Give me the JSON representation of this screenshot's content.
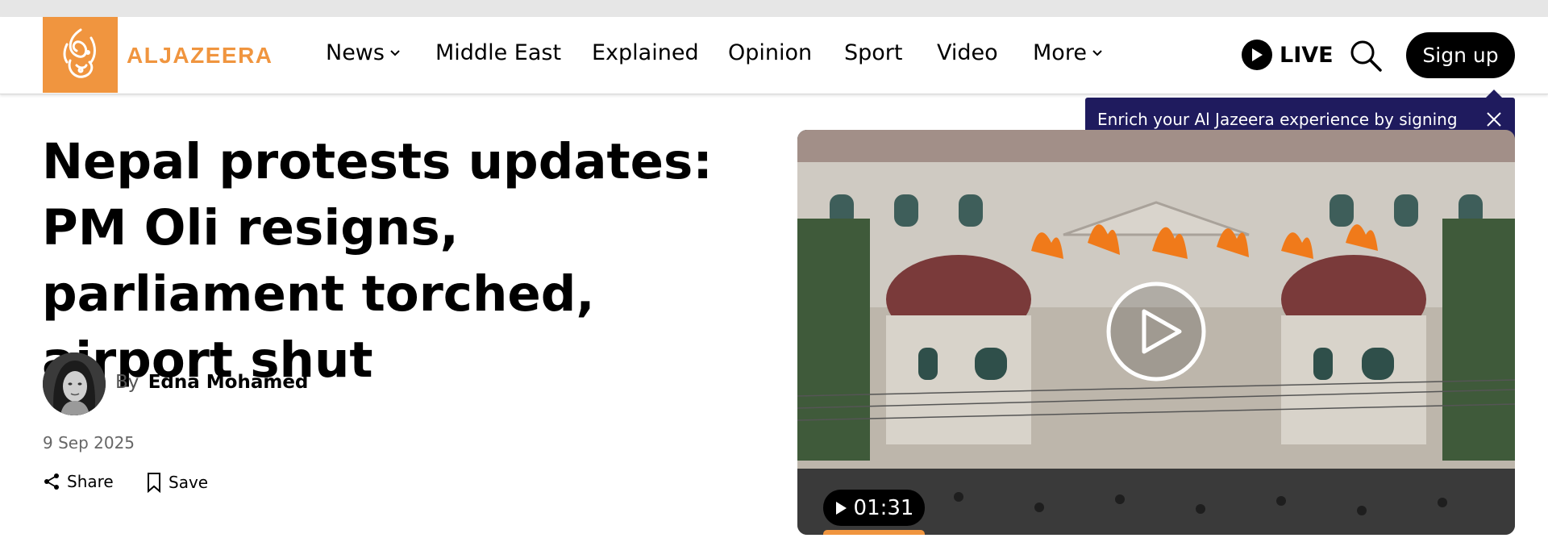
{
  "brand": {
    "logo_text": "ALJAZEERA",
    "accent": "#f0953f"
  },
  "nav": {
    "items": [
      {
        "label": "News",
        "has_dropdown": true
      },
      {
        "label": "Middle East",
        "has_dropdown": false
      },
      {
        "label": "Explained",
        "has_dropdown": false
      },
      {
        "label": "Opinion",
        "has_dropdown": false
      },
      {
        "label": "Sport",
        "has_dropdown": false
      },
      {
        "label": "Video",
        "has_dropdown": false
      },
      {
        "label": "More",
        "has_dropdown": true
      }
    ],
    "live_label": "LIVE",
    "signup_label": "Sign up"
  },
  "tooltip": {
    "text": "Enrich your Al Jazeera experience by signing in or creating an account.",
    "bg_color": "#1f1b5e"
  },
  "article": {
    "headline": "Nepal protests updates: PM Oli resigns, parliament torched, airport shut",
    "by_prefix": "By",
    "author": "Edna Mohamed",
    "date": "9 Sep 2025",
    "share_label": "Share",
    "save_label": "Save"
  },
  "video": {
    "duration": "01:31"
  },
  "icons": [
    "chevron-down-icon",
    "play-icon",
    "search-icon",
    "close-icon",
    "share-icon",
    "bookmark-icon"
  ]
}
